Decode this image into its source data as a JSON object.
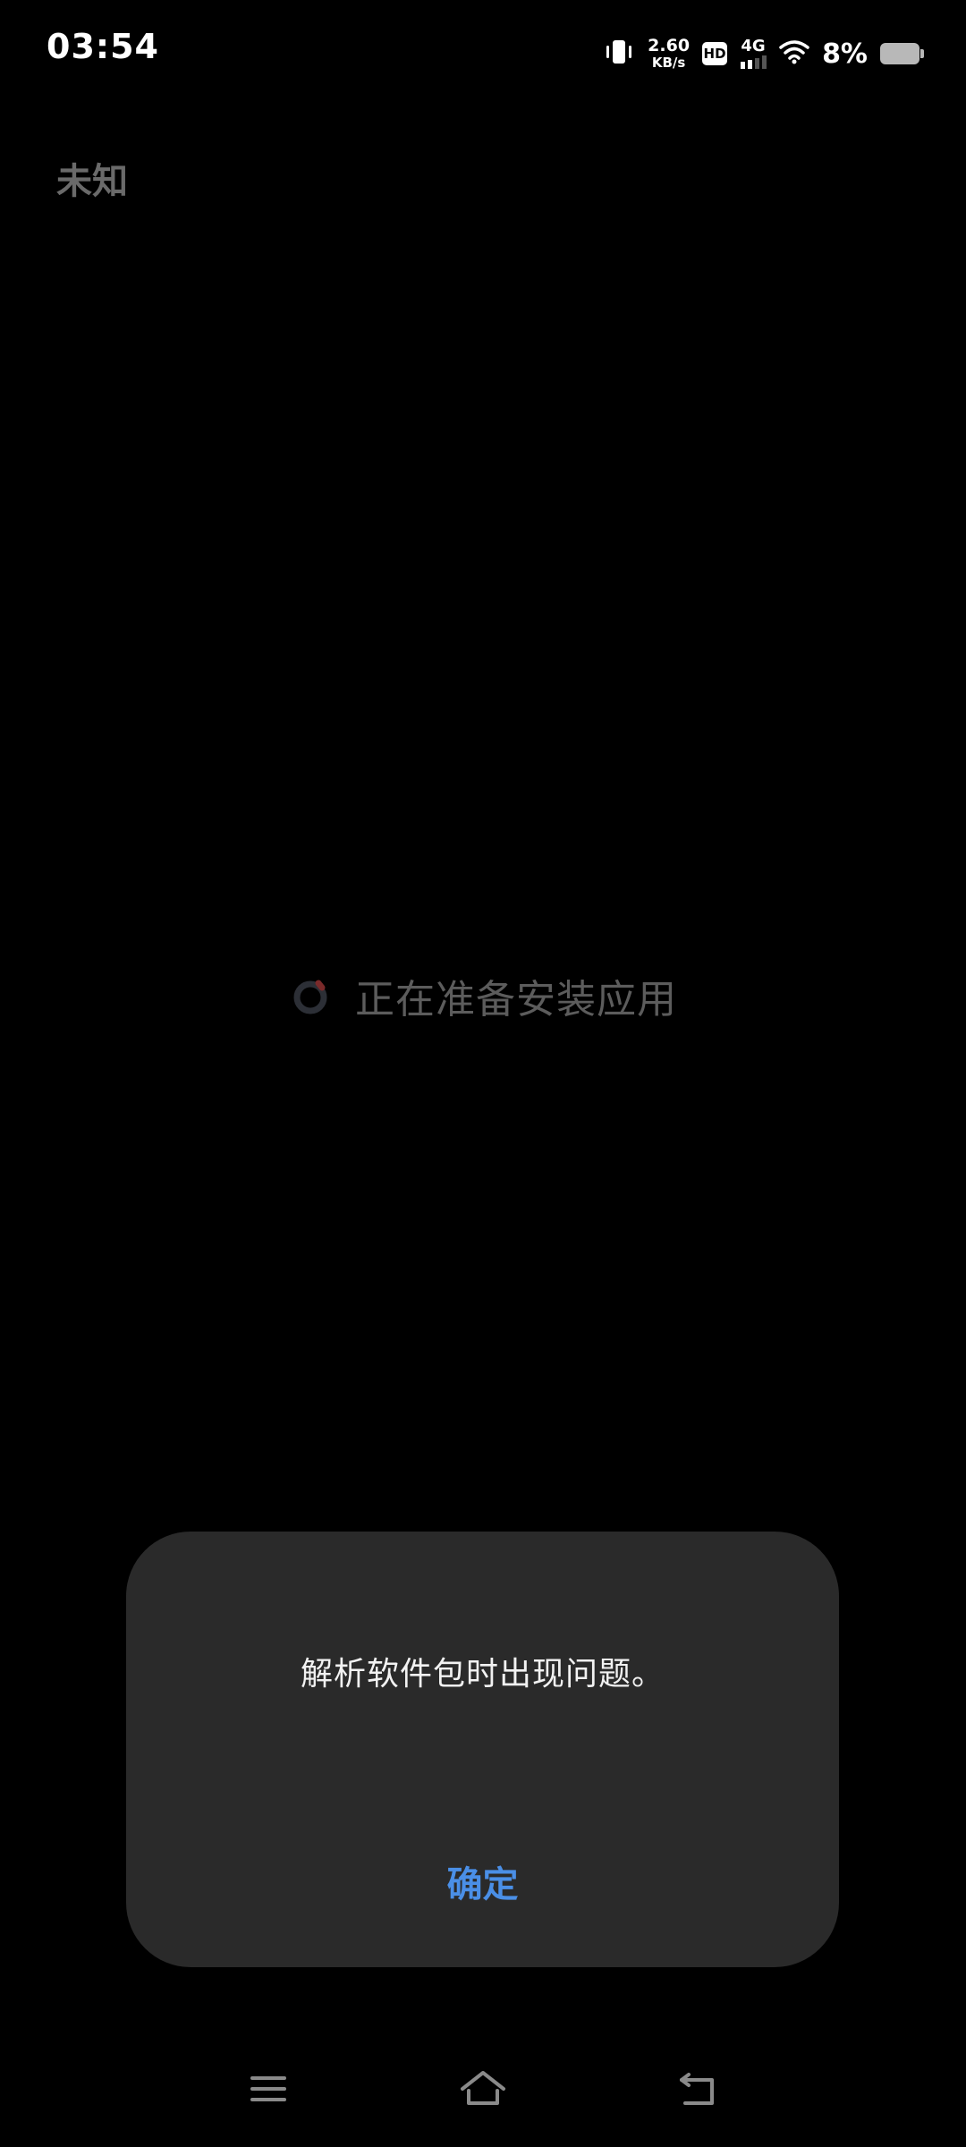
{
  "status_bar": {
    "time": "03:54",
    "speed_value": "2.60",
    "speed_unit": "KB/s",
    "hd_label": "HD",
    "network_label": "4G",
    "battery_percent": "8%",
    "battery_level": 0.08
  },
  "app": {
    "name": "未知",
    "progress_text": "正在准备安装应用"
  },
  "dialog": {
    "message": "解析软件包时出现问题。",
    "ok_label": "确定",
    "accent_color": "#4a8fe7"
  },
  "nav": {
    "menu_icon": "menu-icon",
    "home_icon": "home-icon",
    "back_icon": "back-icon"
  }
}
